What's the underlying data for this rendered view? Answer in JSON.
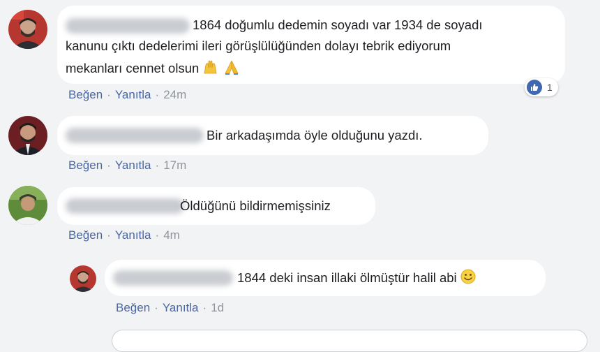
{
  "comments": [
    {
      "text_line1": "1864 doğumlu dedemin soyadı var 1934 de soyadı",
      "text_line2": "kanunu çıktı dedelerimi ileri görüşlülüğünden dolayı tebrik ediyorum",
      "text_line3": "mekanları cennet olsun",
      "emojis": [
        "raised-hands-icon",
        "folded-hands-icon"
      ],
      "like_label": "Beğen",
      "reply_label": "Yanıtla",
      "time": "24m",
      "reaction_count": "1"
    },
    {
      "text": "Bir arkadaşımda öyle olduğunu yazdı.",
      "like_label": "Beğen",
      "reply_label": "Yanıtla",
      "time": "17m"
    },
    {
      "text": "Öldüğünü bildirmemişsiniz",
      "like_label": "Beğen",
      "reply_label": "Yanıtla",
      "time": "4m"
    }
  ],
  "reply": {
    "text": "1844 deki insan illaki ölmüştür halil abi",
    "emoji": "smiley-icon",
    "like_label": "Beğen",
    "reply_label": "Yanıtla",
    "time": "1d"
  },
  "colors": {
    "background": "#f2f3f5",
    "bubble": "#ffffff",
    "link": "#4b67a1",
    "meta": "#90949c",
    "like_blue": "#4267b2"
  }
}
